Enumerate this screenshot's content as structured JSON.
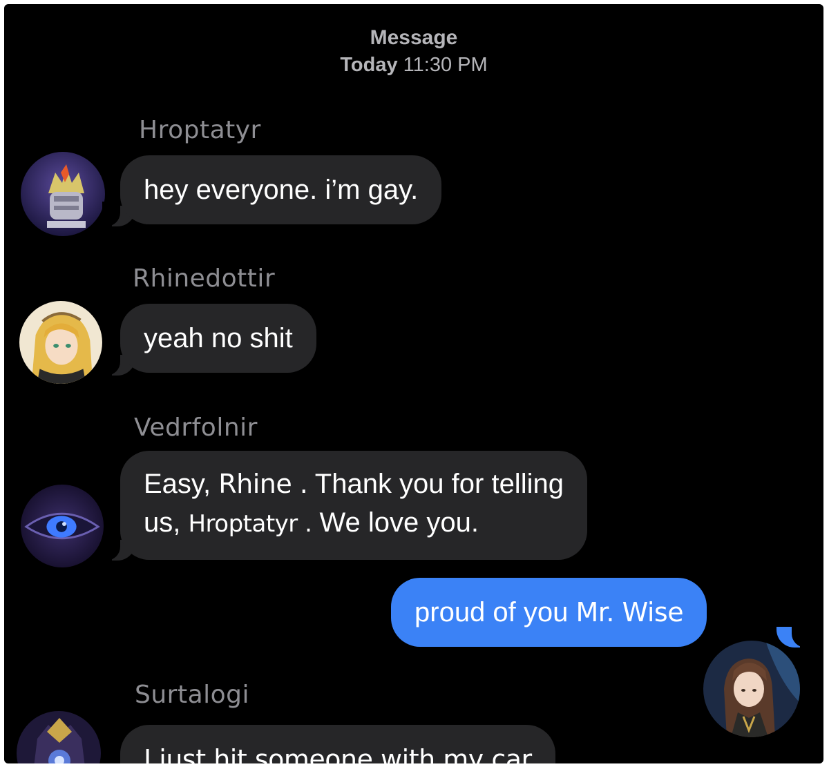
{
  "header": {
    "title": "Message",
    "day": "Today",
    "time": "11:30 PM"
  },
  "messages": [
    {
      "sender": "Hroptatyr",
      "avatar_icon": "crown-guardian-avatar",
      "text": "hey everyone. i’m gay."
    },
    {
      "sender": "Rhinedottir",
      "avatar_icon": "blonde-alchemist-avatar",
      "text": "yeah no shit"
    },
    {
      "sender": "Vedrfolnir",
      "avatar_icon": "blue-eye-avatar",
      "line1_a": "Easy,",
      "line1_name": "Rhine .",
      "line1_b": "Thank you for telling",
      "line2_a": "us,",
      "line2_name": "Hroptatyr .",
      "line2_b": "We love you."
    },
    {
      "sender": "",
      "avatar_icon": "long-haired-man-avatar",
      "text_a": "proud of you",
      "text_name": "Mr. Wise",
      "outgoing": true
    },
    {
      "sender": "Surtalogi",
      "avatar_icon": "dark-armored-avatar",
      "text": "I just hit someone with my car"
    }
  ],
  "colors": {
    "background": "#000000",
    "incoming_bubble": "#262628",
    "outgoing_bubble": "#3b82f6",
    "sender_name": "#8e8e93",
    "header_text": "#b5b5b9"
  }
}
